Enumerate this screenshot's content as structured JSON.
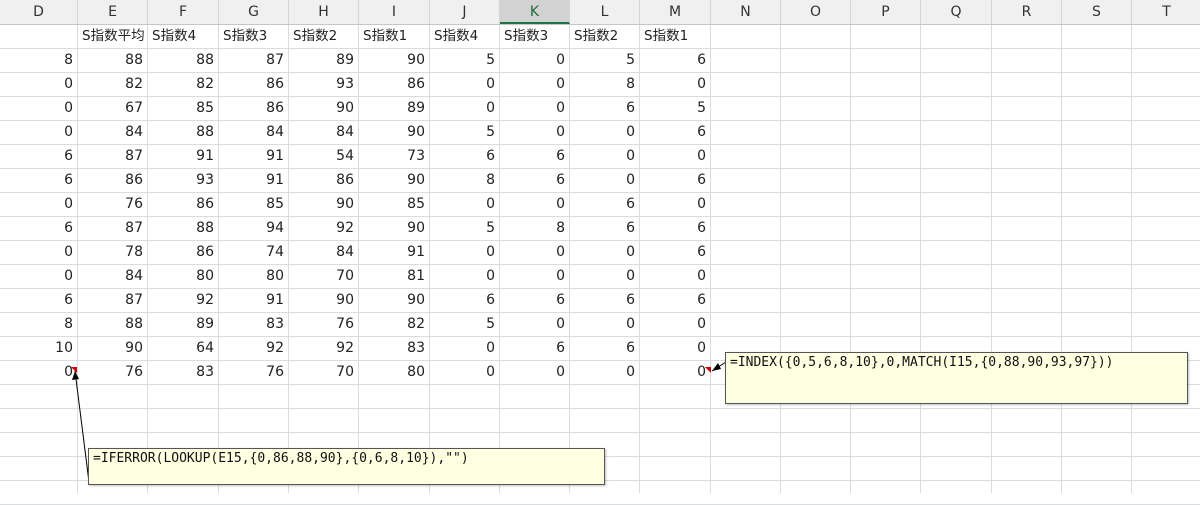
{
  "columns": [
    "D",
    "E",
    "F",
    "G",
    "H",
    "I",
    "J",
    "K",
    "L",
    "M",
    "N",
    "O",
    "P",
    "Q",
    "R",
    "S",
    "T"
  ],
  "selected_column": "K",
  "headers": [
    "",
    "S指数平均",
    "S指数4",
    "S指数3",
    "S指数2",
    "S指数1",
    "S指数4",
    "S指数3",
    "S指数2",
    "S指数1"
  ],
  "rows": [
    [
      "8",
      "88",
      "88",
      "87",
      "89",
      "90",
      "5",
      "0",
      "5",
      "6"
    ],
    [
      "0",
      "82",
      "82",
      "86",
      "93",
      "86",
      "0",
      "0",
      "8",
      "0"
    ],
    [
      "0",
      "67",
      "85",
      "86",
      "90",
      "89",
      "0",
      "0",
      "6",
      "5"
    ],
    [
      "0",
      "84",
      "88",
      "84",
      "84",
      "90",
      "5",
      "0",
      "0",
      "6"
    ],
    [
      "6",
      "87",
      "91",
      "91",
      "54",
      "73",
      "6",
      "6",
      "0",
      "0"
    ],
    [
      "6",
      "86",
      "93",
      "91",
      "86",
      "90",
      "8",
      "6",
      "0",
      "6"
    ],
    [
      "0",
      "76",
      "86",
      "85",
      "90",
      "85",
      "0",
      "0",
      "6",
      "0"
    ],
    [
      "6",
      "87",
      "88",
      "94",
      "92",
      "90",
      "5",
      "8",
      "6",
      "6"
    ],
    [
      "0",
      "78",
      "86",
      "74",
      "84",
      "91",
      "0",
      "0",
      "0",
      "6"
    ],
    [
      "0",
      "84",
      "80",
      "80",
      "70",
      "81",
      "0",
      "0",
      "0",
      "0"
    ],
    [
      "6",
      "87",
      "92",
      "91",
      "90",
      "90",
      "6",
      "6",
      "6",
      "6"
    ],
    [
      "8",
      "88",
      "89",
      "83",
      "76",
      "82",
      "5",
      "0",
      "0",
      "0"
    ],
    [
      "10",
      "90",
      "64",
      "92",
      "92",
      "83",
      "0",
      "6",
      "6",
      "0"
    ],
    [
      "0",
      "76",
      "83",
      "76",
      "70",
      "80",
      "0",
      "0",
      "0",
      "0"
    ]
  ],
  "comments": [
    {
      "text": "=INDEX({0,5,6,8,10},0,MATCH(I15,{0,88,90,93,97}))"
    },
    {
      "text": "=IFERROR(LOOKUP(E15,{0,86,88,90},{0,6,8,10}),\"\")"
    }
  ],
  "colors": {
    "comment_bg": "#ffffe1",
    "selected_header": "#217346",
    "comment_marker": "#d00000"
  }
}
